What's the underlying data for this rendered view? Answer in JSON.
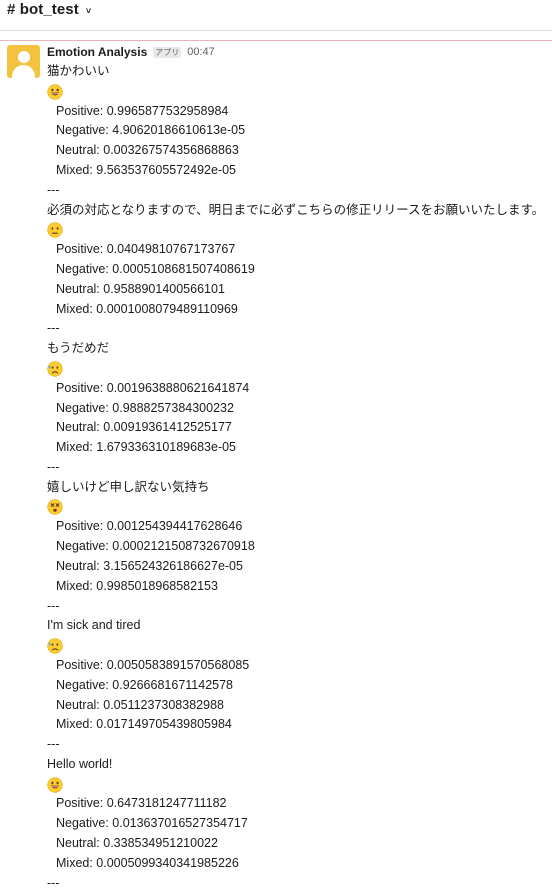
{
  "channel": {
    "name": "# bot_test",
    "chevron": "˅"
  },
  "message": {
    "sender": "Emotion Analysis",
    "badge": "アプリ",
    "time": "00:47",
    "separator": "---",
    "entries": [
      {
        "text": "猫かわいい",
        "emoji": "grinning-face",
        "scores": [
          "Positive: 0.9965877532958984",
          "Negative: 4.90620186610613e-05",
          "Neutral: 0.003267574356868863",
          "Mixed: 9.563537605572492e-05"
        ]
      },
      {
        "text": "必須の対応となりますので、明日までに必ずこちらの修正リリースをお願いいたします。",
        "emoji": "neutral-face",
        "scores": [
          "Positive: 0.04049810767173767",
          "Negative: 0.0005108681507408619",
          "Neutral: 0.9588901400566101",
          "Mixed: 0.0001008079489110969"
        ]
      },
      {
        "text": "もうだめだ",
        "emoji": "sad-sweat-face",
        "scores": [
          "Positive: 0.0019638880621641874",
          "Negative: 0.9888257384300232",
          "Neutral: 0.00919361412525177",
          "Mixed: 1.679336310189683e-05"
        ]
      },
      {
        "text": "嬉しいけど申し訳ない気持ち",
        "emoji": "dizzy-face",
        "scores": [
          "Positive: 0.001254394417628646",
          "Negative: 0.0002121508732670918",
          "Neutral: 3.156524326186627e-05",
          "Mixed: 0.9985018968582153"
        ]
      },
      {
        "text": "I'm sick and tired",
        "emoji": "sad-sweat-face",
        "scores": [
          "Positive: 0.0050583891570568085",
          "Negative: 0.9266681671142578",
          "Neutral: 0.0511237308382988",
          "Mixed: 0.017149705439805984"
        ]
      },
      {
        "text": "Hello world!",
        "emoji": "grinning-face",
        "scores": [
          "Positive: 0.6473181247711182",
          "Negative: 0.013637016527354717",
          "Neutral: 0.338534951210022",
          "Mixed: 0.0005099340341985226"
        ]
      }
    ]
  }
}
